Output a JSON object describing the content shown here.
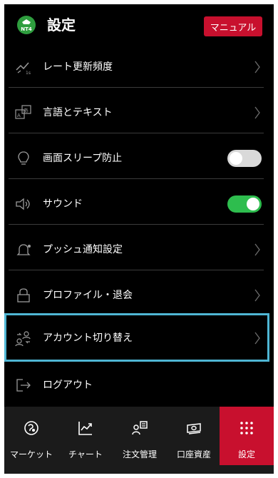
{
  "header": {
    "logo_text": "NT4",
    "title": "設定",
    "manual_label": "マニュアル"
  },
  "rows": [
    {
      "label": "レート更新頻度",
      "icon": "rate-chart-icon",
      "accessory": "chevron"
    },
    {
      "label": "言語とテキスト",
      "icon": "language-icon",
      "accessory": "chevron"
    },
    {
      "label": "画面スリープ防止",
      "icon": "lightbulb-icon",
      "accessory": "toggle",
      "toggle_on": false
    },
    {
      "label": "サウンド",
      "icon": "speaker-icon",
      "accessory": "toggle",
      "toggle_on": true
    },
    {
      "label": "プッシュ通知設定",
      "icon": "bell-icon",
      "accessory": "chevron"
    },
    {
      "label": "プロファイル・退会",
      "icon": "lock-icon",
      "accessory": "chevron"
    },
    {
      "label": "アカウント切り替え",
      "icon": "account-switch-icon",
      "accessory": "chevron",
      "highlighted": true
    },
    {
      "label": "ログアウト",
      "icon": "logout-icon",
      "accessory": "none"
    }
  ],
  "tabs": [
    {
      "label": "マーケット",
      "icon": "market-icon",
      "active": false
    },
    {
      "label": "チャート",
      "icon": "chart-icon",
      "active": false
    },
    {
      "label": "注文管理",
      "icon": "order-management-icon",
      "active": false
    },
    {
      "label": "口座資産",
      "icon": "account-assets-icon",
      "active": false
    },
    {
      "label": "設定",
      "icon": "settings-grid-icon",
      "active": true
    }
  ],
  "colors": {
    "background": "#000000",
    "accent_red": "#c8102e",
    "toggle_on": "#2ebd4e",
    "toggle_off": "#d9d9d9",
    "highlight_border": "#4fb6d4",
    "tabbar": "#1b1b1b"
  }
}
